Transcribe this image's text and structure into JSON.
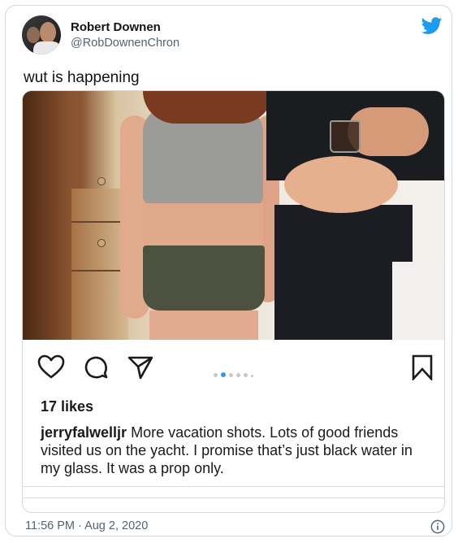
{
  "tweet": {
    "author_name": "Robert Downen",
    "author_handle": "@RobDownenChron",
    "text": "wut is happening",
    "timestamp": "11:56 PM · Aug 2, 2020"
  },
  "embedded_post": {
    "likes": "17 likes",
    "username": "jerryfalwelljr",
    "caption": "More vacation shots.  Lots of good friends visited us on the yacht.  I promise that’s just black water in my glass.  It was a prop only.",
    "carousel_dots": 6,
    "active_dot_index": 1
  },
  "icons": [
    "twitter-bird-icon",
    "heart-icon",
    "comment-icon",
    "share-icon",
    "bookmark-icon",
    "info-icon"
  ],
  "colors": {
    "twitter_blue": "#1d9bf0",
    "instagram_blue": "#3897f0",
    "secondary_text": "#536471"
  }
}
